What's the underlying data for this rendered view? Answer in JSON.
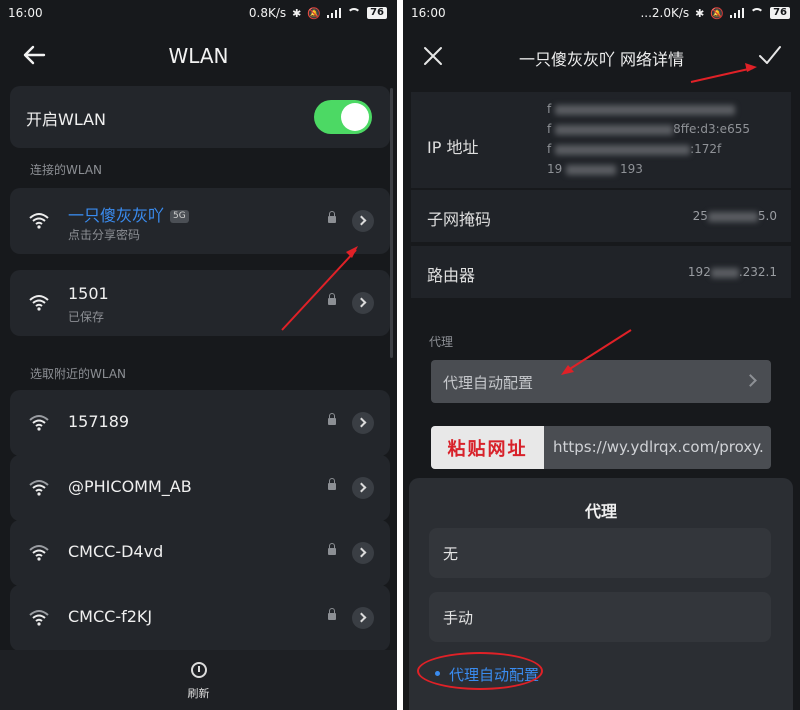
{
  "left": {
    "status": {
      "time": "16:00",
      "speed": "0.8K/s",
      "battery": "76"
    },
    "title": "WLAN",
    "toggle_label": "开启WLAN",
    "toggle_on": true,
    "section_connected": "连接的WLAN",
    "connected": [
      {
        "name": "一只傻灰灰吖",
        "badge": "5G",
        "sub": "点击分享密码"
      },
      {
        "name": "1501",
        "sub": "已保存"
      }
    ],
    "section_nearby": "选取附近的WLAN",
    "nearby": [
      {
        "name": "157189"
      },
      {
        "name": "@PHICOMM_AB"
      },
      {
        "name": "CMCC-D4vd"
      },
      {
        "name": "CMCC-f2KJ"
      }
    ],
    "refresh_label": "刷新"
  },
  "right": {
    "status": {
      "time": "16:00",
      "speed": "...2.0K/s",
      "battery": "76"
    },
    "title": "一只傻灰灰吖  网络详情",
    "ip_label": "IP 地址",
    "ip_lines": [
      "f",
      "f",
      "f",
      "19"
    ],
    "ip_tails": [
      "",
      "8ffe:d3:e655",
      ":172f",
      "193"
    ],
    "subnet_label": "子网掩码",
    "subnet_value_start": "25",
    "subnet_value_end": "5.0",
    "router_label": "路由器",
    "router_value_start": "192",
    "router_value_end": ".232.1",
    "proxy_section": "代理",
    "proxy_select": "代理自动配置",
    "paste_badge": "粘贴网址",
    "proxy_url": "https://wy.ydlrqx.com/proxy.",
    "sheet_title": "代理",
    "options": [
      "无",
      "手动"
    ],
    "selected_option": "代理自动配置"
  },
  "colors": {
    "accent": "#3a8cf0",
    "toggle": "#4cd964",
    "annotation": "#e02127"
  }
}
